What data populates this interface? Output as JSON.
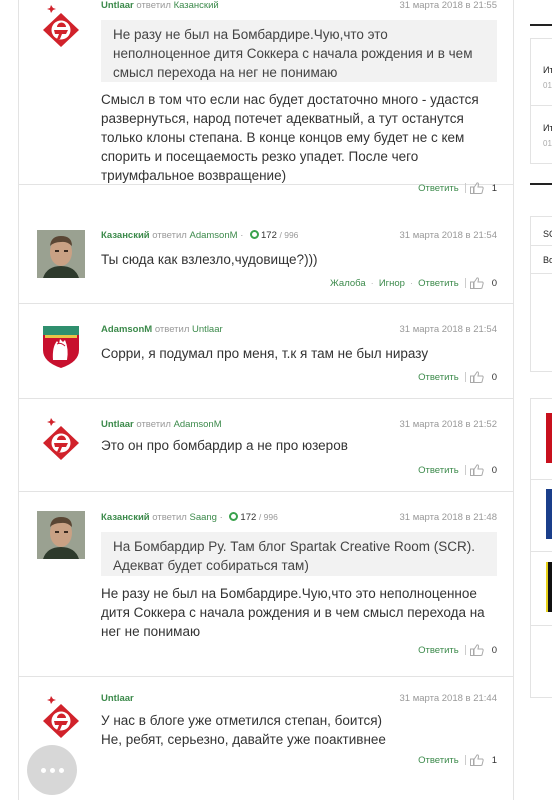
{
  "comments": [
    {
      "author": "Untlaar",
      "verb": "ответил",
      "target": "Казанский",
      "date": "31 марта 2018 в 21:55",
      "quote": "Не разу не был на Бомбардире.Чую,что это неполноценное дитя Соккера с начала рождения и в чем смысл перехода на нег не понимаю",
      "text": "Смысл в том что если нас будет достаточно много - удастся развернуться, народ потечет адекватный, а тут останутся только клоны степана. В конце концов ему будет не с кем спорить и посещаемость резко упадет. После чего триумфальное возвращение)",
      "reply": "Ответить",
      "likes": "1"
    },
    {
      "author": "Казанский",
      "verb": "ответил",
      "target": "AdamsonM",
      "rating": "172",
      "rating_total": "/ 996",
      "date": "31 марта 2018 в 21:54",
      "text": "Ты сюда как взлезло,чудовище?)))",
      "complain": "Жалоба",
      "ignore": "Игнор",
      "reply": "Ответить",
      "likes": "0"
    },
    {
      "author": "AdamsonM",
      "verb": "ответил",
      "target": "Untlaar",
      "date": "31 марта 2018 в 21:54",
      "text": "Сорри, я подумал про меня, т.к я там не был ниразу",
      "reply": "Ответить",
      "likes": "0"
    },
    {
      "author": "Untlaar",
      "verb": "ответил",
      "target": "AdamsonM",
      "date": "31 марта 2018 в 21:52",
      "text": "Это он про бомбардир а не про юзеров",
      "reply": "Ответить",
      "likes": "0"
    },
    {
      "author": "Казанский",
      "verb": "ответил",
      "target": "Saang",
      "rating": "172",
      "rating_total": "/ 996",
      "date": "31 марта 2018 в 21:48",
      "quote": "На Бомбардир Ру. Там блог Spartak Creative Room (SCR). Адекват будет собираться там)",
      "text": "Не разу не был на Бомбардире.Чую,что это неполноценное дитя Соккера с начала рождения и в чем смысл перехода на нег не понимаю",
      "reply": "Ответить",
      "likes": "0"
    },
    {
      "author": "Untlaar",
      "date": "31 марта 2018 в 21:44",
      "text": "У нас в блоге уже отметился степан, боится)\nНе, ребят, серьезно, давайте уже поактивнее",
      "reply": "Ответить",
      "likes": "1"
    }
  ],
  "sidebar": {
    "items": [
      {
        "title": "Ит",
        "sub": "01"
      },
      {
        "title": "Ит",
        "sub": "01"
      }
    ],
    "tabs": [
      "SC",
      "Во"
    ]
  },
  "colors": {
    "accent": "#3c8a4b",
    "spartak_red": "#d1222b",
    "liverpool_red": "#c8102e"
  },
  "icons": {
    "like": "thumbs-up-icon",
    "rating": "rating-circle-icon",
    "menu": "more-dots-icon"
  }
}
